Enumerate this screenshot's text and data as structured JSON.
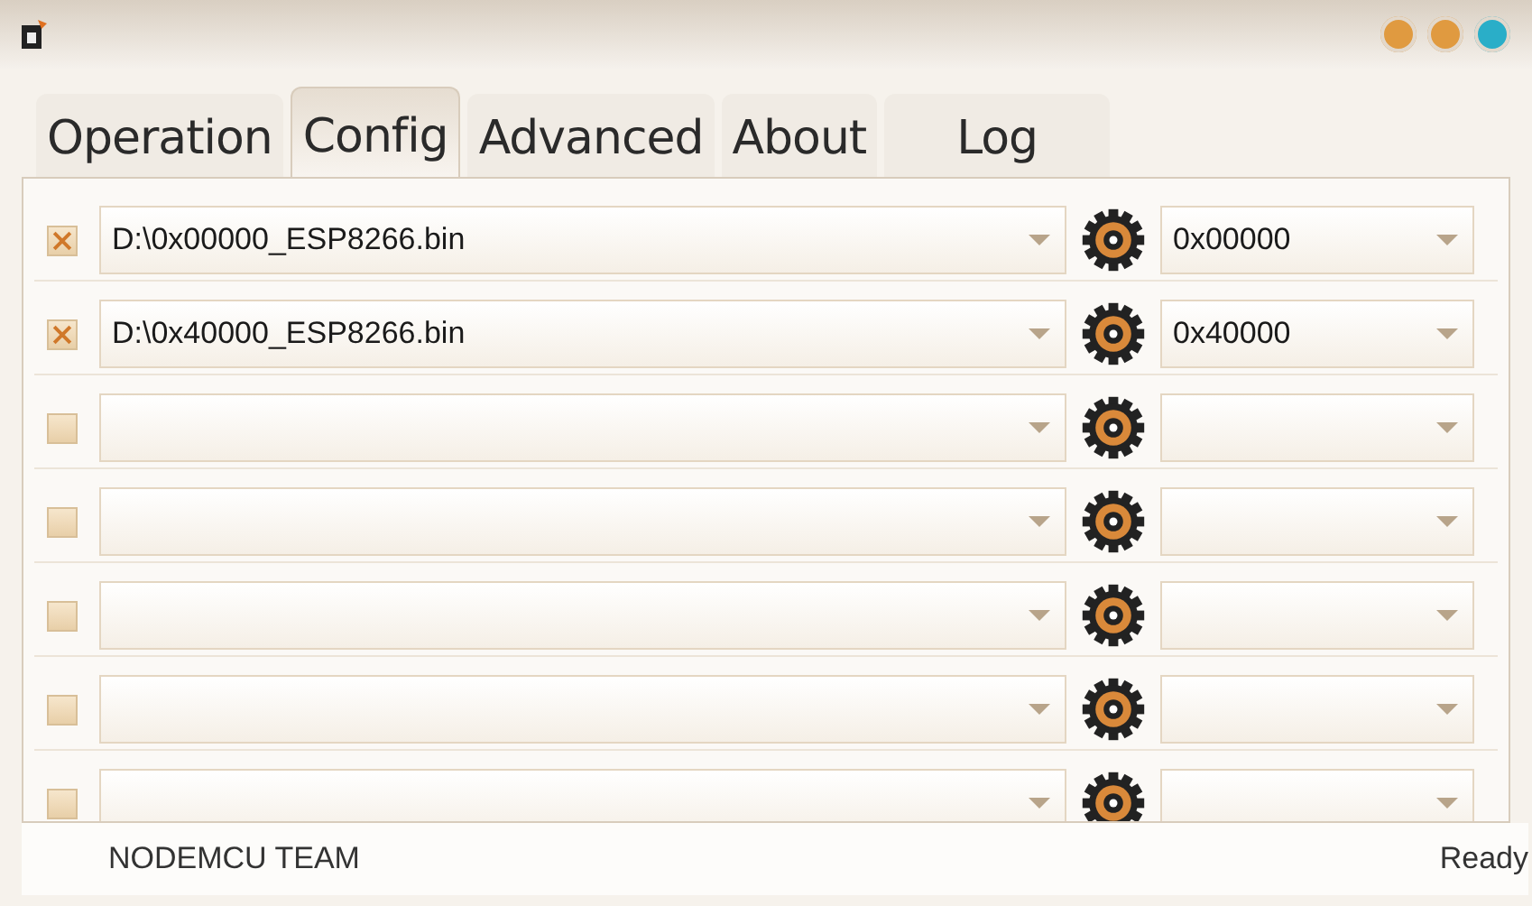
{
  "window": {
    "controls": [
      {
        "color": "#e09a40"
      },
      {
        "color": "#e09a40"
      },
      {
        "color": "#2aaec8"
      }
    ]
  },
  "tabs": [
    {
      "label": "Operation",
      "selected": false
    },
    {
      "label": "Config",
      "selected": true
    },
    {
      "label": "Advanced",
      "selected": false
    },
    {
      "label": "About",
      "selected": false
    },
    {
      "label": "Log",
      "selected": false
    }
  ],
  "rows": [
    {
      "checked": true,
      "file": "D:\\0x00000_ESP8266.bin",
      "address": "0x00000"
    },
    {
      "checked": true,
      "file": "D:\\0x40000_ESP8266.bin",
      "address": "0x40000"
    },
    {
      "checked": false
    },
    {
      "checked": false
    },
    {
      "checked": false
    },
    {
      "checked": false
    },
    {
      "checked": false
    }
  ],
  "status_bar": {
    "left": "NODEMCU TEAM",
    "right": "Ready"
  }
}
